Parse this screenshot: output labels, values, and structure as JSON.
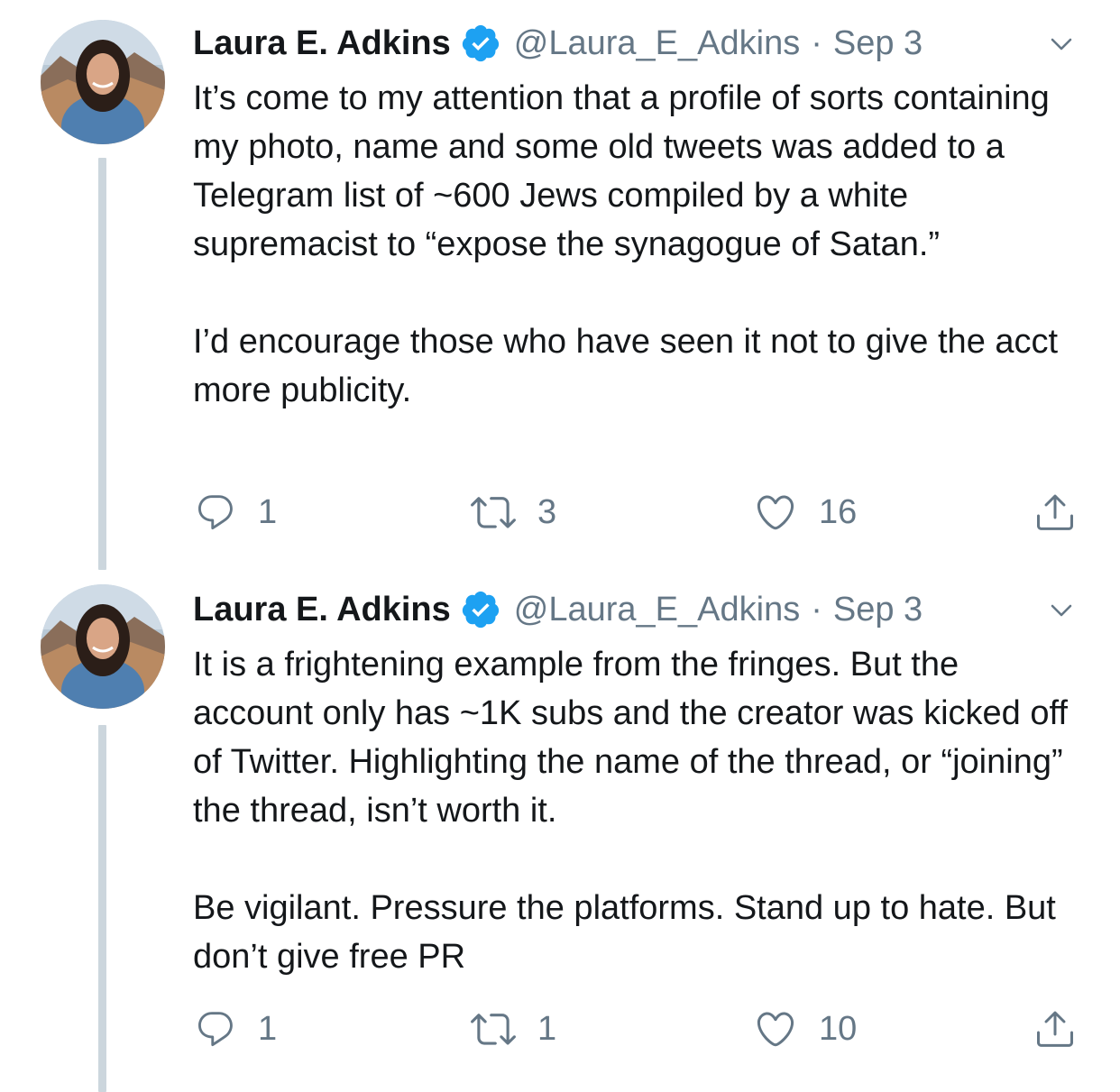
{
  "colors": {
    "text": "#14171a",
    "secondary": "#657786",
    "verified": "#1da1f2",
    "thread_line": "#ccd6dd"
  },
  "tweets": [
    {
      "author_name": "Laura E. Adkins",
      "handle": "@Laura_E_Adkins",
      "separator": "·",
      "date": "Sep 3",
      "verified": true,
      "paragraphs": [
        "It’s come to my attention that a profile of sorts containing my photo, name and some old tweets was added to a Telegram list of ~600 Jews compiled by a white supremacist to “expose the synagogue of Satan.”",
        "I’d encourage those who have seen it not to give the acct more publicity."
      ],
      "replies": "1",
      "retweets": "3",
      "likes": "16",
      "icons": [
        "reply-icon",
        "retweet-icon",
        "heart-icon",
        "share-icon"
      ]
    },
    {
      "author_name": "Laura E. Adkins",
      "handle": "@Laura_E_Adkins",
      "separator": "·",
      "date": "Sep 3",
      "verified": true,
      "paragraphs": [
        "It is a frightening example from the fringes. But the account only has ~1K subs and the creator was kicked off of Twitter. Highlighting the name of the thread, or “joining” the thread, isn’t worth it.",
        "Be vigilant. Pressure the platforms. Stand up to hate. But don’t give free PR"
      ],
      "replies": "1",
      "retweets": "1",
      "likes": "10",
      "icons": [
        "reply-icon",
        "retweet-icon",
        "heart-icon",
        "share-icon"
      ]
    }
  ]
}
